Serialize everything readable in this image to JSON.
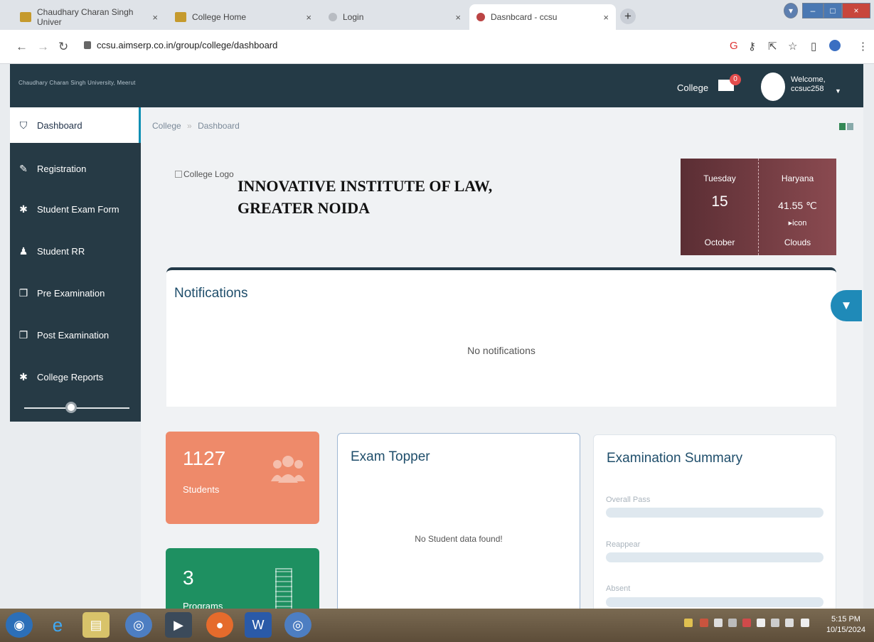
{
  "browser": {
    "tabs": [
      {
        "title": "Chaudhary Charan Singh Univer",
        "close": "×"
      },
      {
        "title": "College Home",
        "close": "×"
      },
      {
        "title": "Login",
        "close": "×"
      },
      {
        "title": "Dasnbcard - ccsu",
        "close": "×"
      }
    ],
    "new_tab": "+",
    "url": "ccsu.aimserp.co.in/group/college/dashboard"
  },
  "app": {
    "brand": "Chaudhary Charan Singh University, Meerut",
    "top_link": "College",
    "mail_count": "0",
    "welcome": "Welcome,",
    "username": "ccsuc258"
  },
  "sidebar": {
    "items": [
      {
        "label": "Dashboard"
      },
      {
        "label": "Registration"
      },
      {
        "label": "Student Exam Form"
      },
      {
        "label": "Student RR"
      },
      {
        "label": "Pre Examination"
      },
      {
        "label": "Post Examination"
      },
      {
        "label": "College Reports"
      }
    ]
  },
  "breadcrumb": {
    "root": "College",
    "sep": "»",
    "current": "Dashboard"
  },
  "college": {
    "logo_alt": "College Logo",
    "name_line1": "INNOVATIVE INSTITUTE OF LAW,",
    "name_line2": "GREATER NOIDA"
  },
  "weather": {
    "day": "Tuesday",
    "date": "15",
    "month": "October",
    "location": "Haryana",
    "temp": "41.55 ℃",
    "icon_alt": "icon",
    "condition": "Clouds"
  },
  "notifications": {
    "title": "Notifications",
    "empty": "No notifications"
  },
  "stats": {
    "students": {
      "value": "1127",
      "label": "Students"
    },
    "programs": {
      "value": "3",
      "label": "Programs"
    }
  },
  "exam_topper": {
    "title": "Exam Topper",
    "empty": "No Student data found!"
  },
  "exam_summary": {
    "title": "Examination Summary",
    "rows": [
      {
        "label": "Overall Pass",
        "value": 0.0
      },
      {
        "label": "Reappear",
        "value": 0.0
      },
      {
        "label": "Absent",
        "value": 0.0
      }
    ]
  },
  "taskbar": {
    "time": "5:15 PM",
    "date": "10/15/2024"
  }
}
